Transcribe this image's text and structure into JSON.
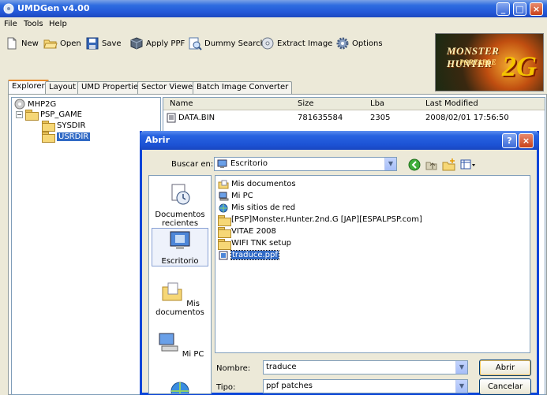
{
  "window": {
    "title": "UMDGen v4.00"
  },
  "menu": [
    "File",
    "Tools",
    "Help"
  ],
  "toolbar": [
    {
      "label": "New",
      "icon": "new-document-icon"
    },
    {
      "label": "Open",
      "icon": "open-folder-icon"
    },
    {
      "label": "Save",
      "icon": "floppy-disk-icon"
    },
    {
      "label": "Apply PPF",
      "icon": "patch-box-icon"
    },
    {
      "label": "Dummy Search",
      "icon": "search-document-icon"
    },
    {
      "label": "Extract Image",
      "icon": "extract-disc-icon"
    },
    {
      "label": "Options",
      "icon": "gear-icon"
    }
  ],
  "banner": {
    "line1": "MONSTER HUNTER",
    "line2": "PORTABLE",
    "line3": "2G"
  },
  "tabs": [
    "Explorer",
    "Layout",
    "UMD Properties",
    "Sector Viewer",
    "Batch Image Converter"
  ],
  "tree": [
    {
      "label": "MHP2G",
      "level": 0
    },
    {
      "label": "PSP_GAME",
      "level": 1
    },
    {
      "label": "SYSDIR",
      "level": 2
    },
    {
      "label": "USRDIR",
      "level": 2,
      "selected": true
    }
  ],
  "list": {
    "headers": [
      "Name",
      "Size",
      "Lba",
      "Last Modified"
    ],
    "rows": [
      {
        "name": "DATA.BIN",
        "size": "781635584",
        "lba": "2305",
        "modified": "2008/02/01   17:56:50"
      }
    ]
  },
  "dialog": {
    "title": "Abrir",
    "look_in_label": "Buscar en:",
    "look_in_value": "Escritorio",
    "places": [
      "Documentos recientes",
      "Escritorio",
      "Mis documentos",
      "Mi PC",
      ""
    ],
    "files": [
      {
        "label": "Mis documentos",
        "icon": "folder-docs-icon"
      },
      {
        "label": "Mi PC",
        "icon": "computer-icon"
      },
      {
        "label": "Mis sitios de red",
        "icon": "network-icon"
      },
      {
        "label": "[PSP]Monster.Hunter.2nd.G [JAP][ESPALPSP.com]",
        "icon": "folder-icon"
      },
      {
        "label": "VITAE 2008",
        "icon": "folder-icon"
      },
      {
        "label": "WIFI TNK setup",
        "icon": "folder-icon"
      },
      {
        "label": "traduce.ppf",
        "icon": "ppf-file-icon",
        "selected": true
      }
    ],
    "filename_label": "Nombre:",
    "filename_value": "traduce",
    "filetype_label": "Tipo:",
    "filetype_value": "ppf patches",
    "open_button": "Abrir",
    "cancel_button": "Cancelar"
  }
}
